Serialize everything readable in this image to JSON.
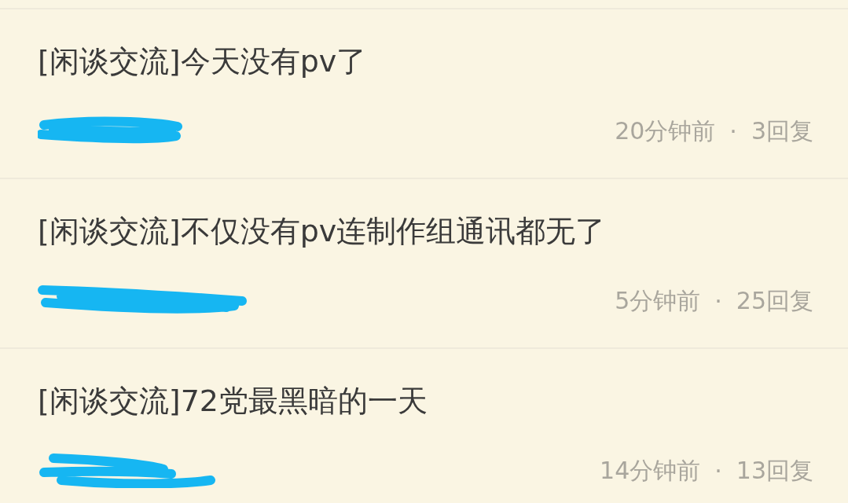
{
  "posts": [
    {
      "title": "[闲谈交流]今天没有pv了",
      "time": "20分钟前",
      "separator": "·",
      "replies": "3回复"
    },
    {
      "title": "[闲谈交流]不仅没有pv连制作组通讯都无了",
      "time": "5分钟前",
      "separator": "·",
      "replies": "25回复"
    },
    {
      "title": "[闲谈交流]72党最黑暗的一天",
      "time": "14分钟前",
      "separator": "·",
      "replies": "13回复"
    }
  ]
}
